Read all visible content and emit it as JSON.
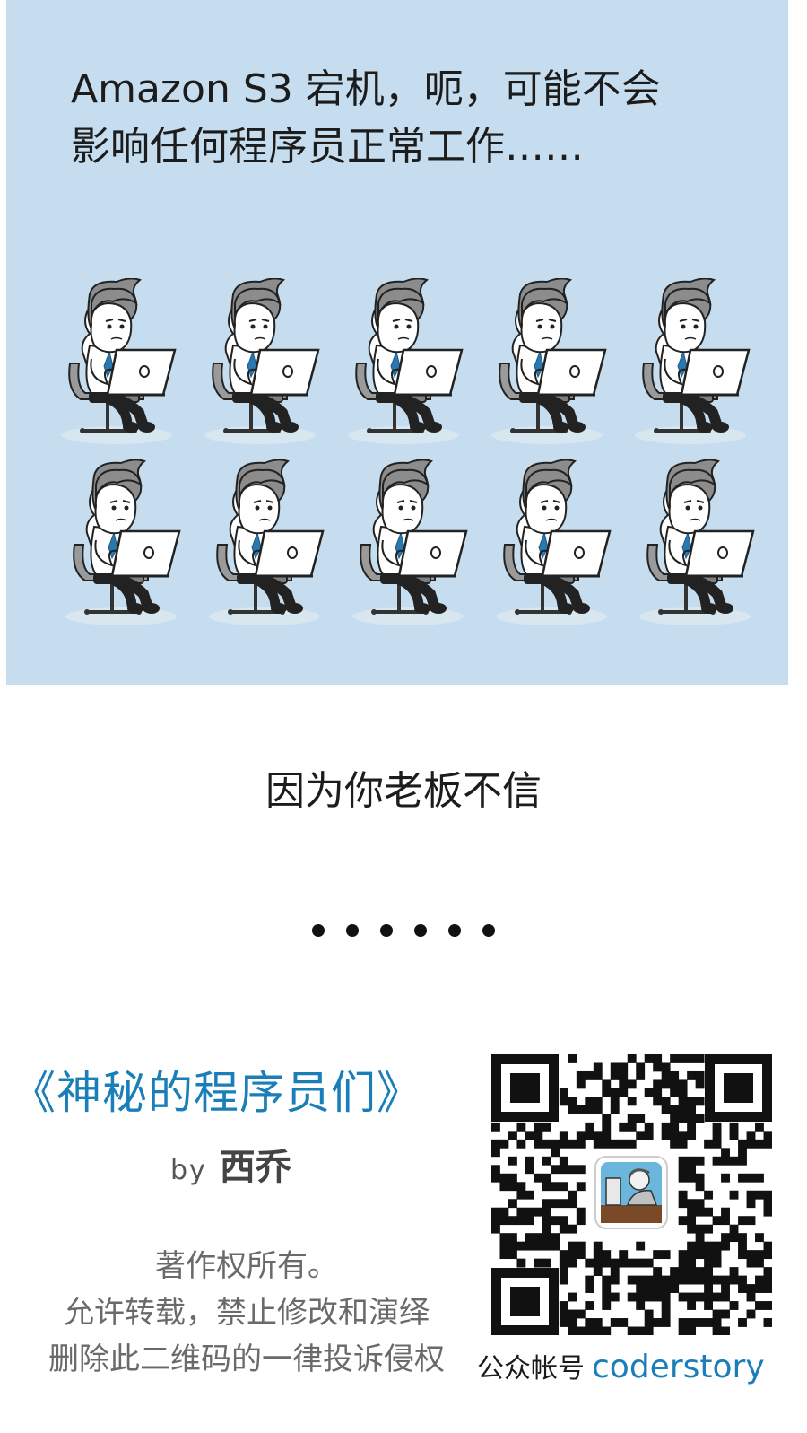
{
  "comic": {
    "caption_lines": [
      "Amazon S3 宕机，呃，可能不会",
      "影响任何程序员正常工作……"
    ],
    "background_color": "#c5ddee",
    "figures": "10 identical programmers sitting on office chairs with laptops, two rows of five",
    "punchline": "因为你老板不信",
    "dot_count": 6
  },
  "footer": {
    "book_title": "《神秘的程序员们》",
    "by": "by",
    "author": "西乔",
    "copyright_lines": [
      "著作权所有。",
      "允许转载，禁止修改和演绎",
      "删除此二维码的一律投诉侵权"
    ],
    "account_label": "公众帐号",
    "account_handle": "coderstory",
    "accent_color": "#1a7fb8"
  }
}
